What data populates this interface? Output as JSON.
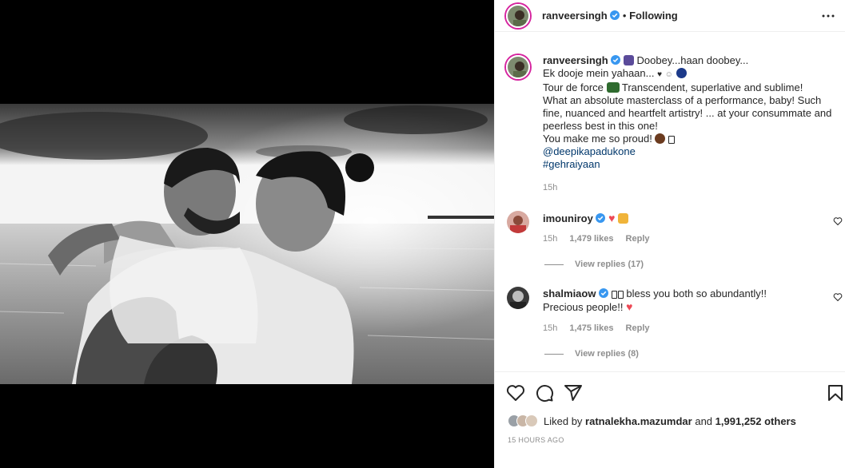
{
  "post": {
    "username": "ranveersingh",
    "follow_state": "Following",
    "dot": "•"
  },
  "caption": {
    "username": "ranveersingh",
    "line1": "Doobey...haan doobey...",
    "line2": "Ek dooje mein yahaan...",
    "line3a": "Tour de force",
    "line3b": "Transcendent, superlative and sublime!",
    "line4": "What an absolute masterclass of a performance, baby! Such fine, nuanced and heartfelt artistry! ... at your consummate and peerless best in this one!",
    "line5": "You make me so proud!",
    "mention": "@deepikapadukone",
    "hashtag": "#gehraiyaan",
    "time": "15h"
  },
  "comments": [
    {
      "username": "imouniroy",
      "text": "",
      "time": "15h",
      "likes": "1,479 likes",
      "reply": "Reply",
      "view_replies": "View replies (17)"
    },
    {
      "username": "shalmiaow",
      "text": "bless you both so abundantly!! Precious people!!",
      "time": "15h",
      "likes": "1,475 likes",
      "reply": "Reply",
      "view_replies": "View replies (8)"
    }
  ],
  "likes": {
    "prefix": "Liked by",
    "user": "ratnalekha.mazumdar",
    "and": "and",
    "others": "1,991,252 others"
  },
  "time_ago": "15 HOURS AGO",
  "icons": [
    "more-icon",
    "verified-icon",
    "heart-icon",
    "comment-icon",
    "share-icon",
    "bookmark-icon"
  ],
  "colors": {
    "link": "#00376b",
    "muted": "#8e8e8e",
    "verified": "#3897f0",
    "heart": "#ed4956"
  }
}
